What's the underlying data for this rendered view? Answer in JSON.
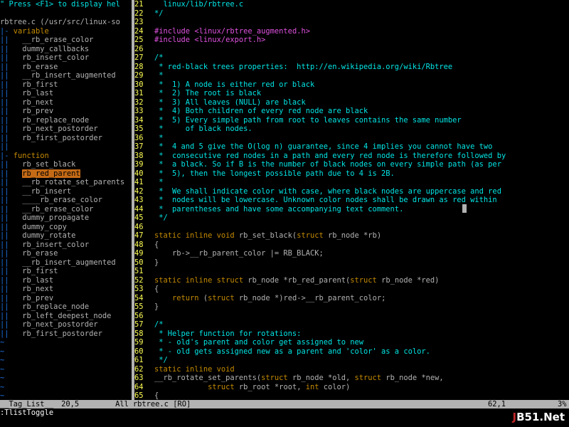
{
  "colors": {
    "background": "#000000",
    "text": "#b2b2b2",
    "comment": "#00e5e5",
    "keyword": "#c58b00",
    "line_number": "#ffff54",
    "preproc": "#e052e0",
    "gutter": "#1e72e0",
    "string": "#e052e0",
    "selection_bg": "#c46a16",
    "status_bar": "#b2b2b2"
  },
  "taglist": {
    "lines": [
      [
        {
          "t": "\" Press <F1> to display hel",
          "c": "comment"
        }
      ],
      [
        {
          "t": "",
          "c": "text"
        }
      ],
      [
        {
          "t": "rbtree.c (/usr/src/linux-so",
          "c": "text"
        }
      ],
      [
        {
          "t": "|-",
          "c": "gutter"
        },
        {
          "t": " variable",
          "c": "keyword"
        }
      ],
      [
        {
          "t": "||",
          "c": "gutter"
        },
        {
          "t": "   __rb_erase_color",
          "c": "text"
        }
      ],
      [
        {
          "t": "||",
          "c": "gutter"
        },
        {
          "t": "   dummy_callbacks",
          "c": "text"
        }
      ],
      [
        {
          "t": "||",
          "c": "gutter"
        },
        {
          "t": "   rb_insert_color",
          "c": "text"
        }
      ],
      [
        {
          "t": "||",
          "c": "gutter"
        },
        {
          "t": "   rb_erase",
          "c": "text"
        }
      ],
      [
        {
          "t": "||",
          "c": "gutter"
        },
        {
          "t": "   __rb_insert_augmented",
          "c": "text"
        }
      ],
      [
        {
          "t": "||",
          "c": "gutter"
        },
        {
          "t": "   rb_first",
          "c": "text"
        }
      ],
      [
        {
          "t": "||",
          "c": "gutter"
        },
        {
          "t": "   rb_last",
          "c": "text"
        }
      ],
      [
        {
          "t": "||",
          "c": "gutter"
        },
        {
          "t": "   rb_next",
          "c": "text"
        }
      ],
      [
        {
          "t": "||",
          "c": "gutter"
        },
        {
          "t": "   rb_prev",
          "c": "text"
        }
      ],
      [
        {
          "t": "||",
          "c": "gutter"
        },
        {
          "t": "   rb_replace_node",
          "c": "text"
        }
      ],
      [
        {
          "t": "||",
          "c": "gutter"
        },
        {
          "t": "   rb_next_postorder",
          "c": "text"
        }
      ],
      [
        {
          "t": "||",
          "c": "gutter"
        },
        {
          "t": "   rb_first_postorder",
          "c": "text"
        }
      ],
      [
        {
          "t": "||",
          "c": "gutter"
        }
      ],
      [
        {
          "t": "|-",
          "c": "gutter"
        },
        {
          "t": " function",
          "c": "keyword"
        }
      ],
      [
        {
          "t": "||",
          "c": "gutter"
        },
        {
          "t": "   rb_set_black",
          "c": "text"
        }
      ],
      [
        {
          "t": "||",
          "c": "gutter"
        },
        {
          "t": "   ",
          "c": "text"
        },
        {
          "t": "rb_red_parent",
          "c": "selected"
        }
      ],
      [
        {
          "t": "||",
          "c": "gutter"
        },
        {
          "t": "   __rb_rotate_set_parents",
          "c": "text"
        }
      ],
      [
        {
          "t": "||",
          "c": "gutter"
        },
        {
          "t": "   __rb_insert",
          "c": "text"
        }
      ],
      [
        {
          "t": "||",
          "c": "gutter"
        },
        {
          "t": "   ____rb_erase_color",
          "c": "text"
        }
      ],
      [
        {
          "t": "||",
          "c": "gutter"
        },
        {
          "t": "   __rb_erase_color",
          "c": "text"
        }
      ],
      [
        {
          "t": "||",
          "c": "gutter"
        },
        {
          "t": "   dummy_propagate",
          "c": "text"
        }
      ],
      [
        {
          "t": "||",
          "c": "gutter"
        },
        {
          "t": "   dummy_copy",
          "c": "text"
        }
      ],
      [
        {
          "t": "||",
          "c": "gutter"
        },
        {
          "t": "   dummy_rotate",
          "c": "text"
        }
      ],
      [
        {
          "t": "||",
          "c": "gutter"
        },
        {
          "t": "   rb_insert_color",
          "c": "text"
        }
      ],
      [
        {
          "t": "||",
          "c": "gutter"
        },
        {
          "t": "   rb_erase",
          "c": "text"
        }
      ],
      [
        {
          "t": "||",
          "c": "gutter"
        },
        {
          "t": "   __rb_insert_augmented",
          "c": "text"
        }
      ],
      [
        {
          "t": "||",
          "c": "gutter"
        },
        {
          "t": "   rb_first",
          "c": "text"
        }
      ],
      [
        {
          "t": "||",
          "c": "gutter"
        },
        {
          "t": "   rb_last",
          "c": "text"
        }
      ],
      [
        {
          "t": "||",
          "c": "gutter"
        },
        {
          "t": "   rb_next",
          "c": "text"
        }
      ],
      [
        {
          "t": "||",
          "c": "gutter"
        },
        {
          "t": "   rb_prev",
          "c": "text"
        }
      ],
      [
        {
          "t": "||",
          "c": "gutter"
        },
        {
          "t": "   rb_replace_node",
          "c": "text"
        }
      ],
      [
        {
          "t": "||",
          "c": "gutter"
        },
        {
          "t": "   rb_left_deepest_node",
          "c": "text"
        }
      ],
      [
        {
          "t": "||",
          "c": "gutter"
        },
        {
          "t": "   rb_next_postorder",
          "c": "text"
        }
      ],
      [
        {
          "t": "||",
          "c": "gutter"
        },
        {
          "t": "   rb_first_postorder",
          "c": "text"
        }
      ],
      [
        {
          "t": "~",
          "c": "gutter"
        }
      ],
      [
        {
          "t": "~",
          "c": "gutter"
        }
      ],
      [
        {
          "t": "~",
          "c": "gutter"
        }
      ],
      [
        {
          "t": "~",
          "c": "gutter"
        }
      ],
      [
        {
          "t": "~",
          "c": "gutter"
        }
      ],
      [
        {
          "t": "~",
          "c": "gutter"
        }
      ],
      [
        {
          "t": "~",
          "c": "gutter"
        }
      ]
    ]
  },
  "editor": {
    "lines": [
      {
        "n": "21",
        "s": [
          {
            "t": "  linux/lib/rbtree.c",
            "c": "comment"
          }
        ]
      },
      {
        "n": "22",
        "s": [
          {
            "t": "*/",
            "c": "comment"
          }
        ]
      },
      {
        "n": "23",
        "s": []
      },
      {
        "n": "24",
        "s": [
          {
            "t": "#include ",
            "c": "preproc"
          },
          {
            "t": "<linux/rbtree_augmented.h>",
            "c": "string"
          }
        ]
      },
      {
        "n": "25",
        "s": [
          {
            "t": "#include ",
            "c": "preproc"
          },
          {
            "t": "<linux/export.h>",
            "c": "string"
          }
        ]
      },
      {
        "n": "26",
        "s": []
      },
      {
        "n": "27",
        "s": [
          {
            "t": "/*",
            "c": "comment"
          }
        ]
      },
      {
        "n": "28",
        "s": [
          {
            "t": " * red-black trees properties:  http://en.wikipedia.org/wiki/Rbtree",
            "c": "comment"
          }
        ]
      },
      {
        "n": "29",
        "s": [
          {
            "t": " *",
            "c": "comment"
          }
        ]
      },
      {
        "n": "30",
        "s": [
          {
            "t": " *  1) A node is either red or black",
            "c": "comment"
          }
        ]
      },
      {
        "n": "31",
        "s": [
          {
            "t": " *  2) The root is black",
            "c": "comment"
          }
        ]
      },
      {
        "n": "32",
        "s": [
          {
            "t": " *  3) All leaves (NULL) are black",
            "c": "comment"
          }
        ]
      },
      {
        "n": "33",
        "s": [
          {
            "t": " *  4) Both children of every red node are black",
            "c": "comment"
          }
        ]
      },
      {
        "n": "34",
        "s": [
          {
            "t": " *  5) Every simple path from root to leaves contains the same number",
            "c": "comment"
          }
        ]
      },
      {
        "n": "35",
        "s": [
          {
            "t": " *     of black nodes.",
            "c": "comment"
          }
        ]
      },
      {
        "n": "36",
        "s": [
          {
            "t": " *",
            "c": "comment"
          }
        ]
      },
      {
        "n": "37",
        "s": [
          {
            "t": " *  4 and 5 give the O(log n) guarantee, since 4 implies you cannot have two",
            "c": "comment"
          }
        ]
      },
      {
        "n": "38",
        "s": [
          {
            "t": " *  consecutive red nodes in a path and every red node is therefore followed by",
            "c": "comment"
          }
        ]
      },
      {
        "n": "39",
        "s": [
          {
            "t": " *  a black. So if B is the number of black nodes on every simple path (as per",
            "c": "comment"
          }
        ]
      },
      {
        "n": "40",
        "s": [
          {
            "t": " *  5), then the longest possible path due to 4 is 2B.",
            "c": "comment"
          }
        ]
      },
      {
        "n": "41",
        "s": [
          {
            "t": " *",
            "c": "comment"
          }
        ]
      },
      {
        "n": "42",
        "s": [
          {
            "t": " *  We shall indicate color with case, where black nodes are uppercase and red",
            "c": "comment"
          }
        ]
      },
      {
        "n": "43",
        "s": [
          {
            "t": " *  nodes will be lowercase. Unknown color nodes shall be drawn as red within",
            "c": "comment"
          }
        ]
      },
      {
        "n": "44",
        "s": [
          {
            "t": " *  parentheses and have some accompanying text comment.",
            "c": "comment"
          }
        ]
      },
      {
        "n": "45",
        "s": [
          {
            "t": " */",
            "c": "comment"
          }
        ]
      },
      {
        "n": "46",
        "s": []
      },
      {
        "n": "47",
        "s": [
          {
            "t": "static inline void",
            "c": "keyword"
          },
          {
            "t": " rb_set_black(",
            "c": "text"
          },
          {
            "t": "struct",
            "c": "keyword"
          },
          {
            "t": " rb_node *rb)",
            "c": "text"
          }
        ]
      },
      {
        "n": "48",
        "s": [
          {
            "t": "{",
            "c": "text"
          }
        ]
      },
      {
        "n": "49",
        "s": [
          {
            "t": "    rb->__rb_parent_color |= RB_BLACK;",
            "c": "text"
          }
        ]
      },
      {
        "n": "50",
        "s": [
          {
            "t": "}",
            "c": "text"
          }
        ]
      },
      {
        "n": "51",
        "s": []
      },
      {
        "n": "52",
        "s": [
          {
            "t": "static inline struct",
            "c": "keyword"
          },
          {
            "t": " rb_node *rb_red_parent(",
            "c": "text"
          },
          {
            "t": "struct",
            "c": "keyword"
          },
          {
            "t": " rb_node *red)",
            "c": "text"
          }
        ]
      },
      {
        "n": "53",
        "s": [
          {
            "t": "{",
            "c": "text"
          }
        ]
      },
      {
        "n": "54",
        "s": [
          {
            "t": "    ",
            "c": "text"
          },
          {
            "t": "return",
            "c": "keyword"
          },
          {
            "t": " (",
            "c": "text"
          },
          {
            "t": "struct",
            "c": "keyword"
          },
          {
            "t": " rb_node *)red->__rb_parent_color;",
            "c": "text"
          }
        ]
      },
      {
        "n": "55",
        "s": [
          {
            "t": "}",
            "c": "text"
          }
        ]
      },
      {
        "n": "56",
        "s": []
      },
      {
        "n": "57",
        "s": [
          {
            "t": "/*",
            "c": "comment"
          }
        ]
      },
      {
        "n": "58",
        "s": [
          {
            "t": " * Helper function for rotations:",
            "c": "comment"
          }
        ]
      },
      {
        "n": "59",
        "s": [
          {
            "t": " * - old's parent and color get assigned to new",
            "c": "comment"
          }
        ]
      },
      {
        "n": "60",
        "s": [
          {
            "t": " * - old gets assigned new as a parent and 'color' as a color.",
            "c": "comment"
          }
        ]
      },
      {
        "n": "61",
        "s": [
          {
            "t": " */",
            "c": "comment"
          }
        ]
      },
      {
        "n": "62",
        "s": [
          {
            "t": "static inline void",
            "c": "keyword"
          }
        ]
      },
      {
        "n": "63",
        "s": [
          {
            "t": "__rb_rotate_set_parents(",
            "c": "text"
          },
          {
            "t": "struct",
            "c": "keyword"
          },
          {
            "t": " rb_node *old, ",
            "c": "text"
          },
          {
            "t": "struct",
            "c": "keyword"
          },
          {
            "t": " rb_node *new,",
            "c": "text"
          }
        ]
      },
      {
        "n": "64",
        "s": [
          {
            "t": "            ",
            "c": "text"
          },
          {
            "t": "struct",
            "c": "keyword"
          },
          {
            "t": " rb_root *root, ",
            "c": "text"
          },
          {
            "t": "int",
            "c": "keyword"
          },
          {
            "t": " color)",
            "c": "text"
          }
        ]
      },
      {
        "n": "65",
        "s": [
          {
            "t": "{",
            "c": "text"
          }
        ]
      }
    ]
  },
  "status": {
    "left_name": "__Tag_List__",
    "left_pos": "20,5",
    "left_scroll": "All",
    "file": "rbtree.c [RO]",
    "cursor_pos": "62,1",
    "file_scroll": "3%"
  },
  "cmdline": ":TlistToggle",
  "watermark": {
    "prefix": "J",
    "rest": "B51.Net"
  }
}
